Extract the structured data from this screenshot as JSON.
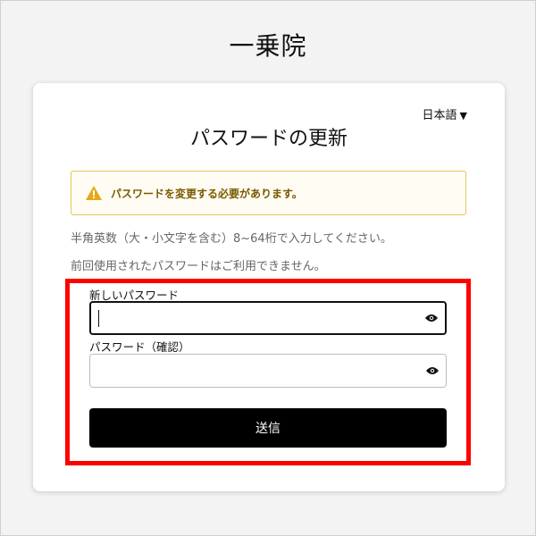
{
  "brand": {
    "title": "一乗院"
  },
  "card": {
    "language": "日本語",
    "title": "パスワードの更新",
    "alert": {
      "text": "パスワードを変更する必要があります。",
      "icon": "warning-icon",
      "color": "#e6a817"
    },
    "notes": [
      "半角英数（大・小文字を含む）8~64桁で入力してください。",
      "前回使用されたパスワードはご利用できません。"
    ],
    "fields": {
      "new_password": {
        "label": "新しいパスワード",
        "value": "",
        "icon": "eye-icon"
      },
      "confirm_password": {
        "label": "パスワード（確認）",
        "value": "",
        "icon": "eye-icon"
      }
    },
    "submit_label": "送信"
  },
  "highlight_color": "#ff0000"
}
